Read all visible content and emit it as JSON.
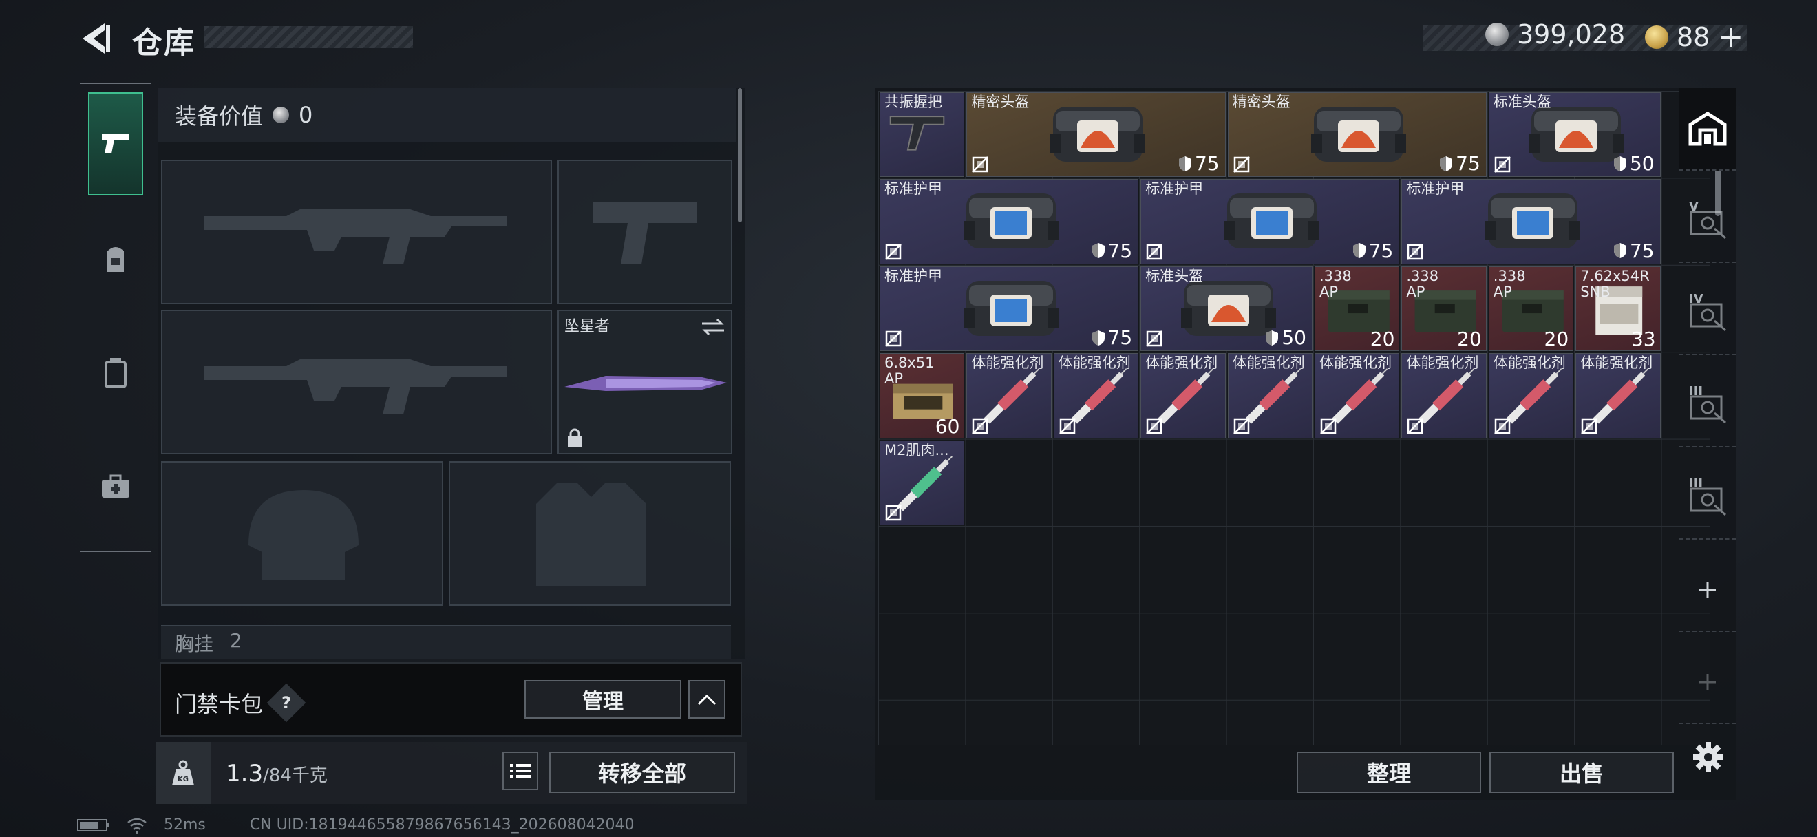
{
  "header": {
    "title": "仓库",
    "back_icon": "back-arrow-icon"
  },
  "currency": {
    "silver": "399,028",
    "gold": "88",
    "plus": "+"
  },
  "left_rail": {
    "tabs": [
      {
        "name": "weapon",
        "icon": "pistol-icon",
        "active": true
      },
      {
        "name": "gear",
        "icon": "backpack-icon",
        "active": false
      },
      {
        "name": "container",
        "icon": "canister-icon",
        "active": false
      },
      {
        "name": "kit",
        "icon": "medkit-icon",
        "active": false
      }
    ]
  },
  "loadout": {
    "equip_value_label": "装备价值",
    "equip_value": "0",
    "melee_name": "坠星者",
    "chest_label": "胸挂",
    "chest_count": "2"
  },
  "keycase": {
    "label": "门禁卡包",
    "help": "?",
    "manage": "管理"
  },
  "bottom_left": {
    "weight": "1.3",
    "weight_max": "/84千克",
    "transfer_all": "转移全部"
  },
  "stash": {
    "items": [
      {
        "name": "共振握把",
        "rarity": "purple",
        "cols": 1,
        "rows": 1,
        "r": 0,
        "c": 0,
        "art": "grip",
        "tag": ""
      },
      {
        "name": "精密头盔",
        "rarity": "gold",
        "cols": 3,
        "rows": 1,
        "r": 0,
        "c": 1,
        "art": "bag-orange",
        "tag": "75",
        "lock": true
      },
      {
        "name": "精密头盔",
        "rarity": "gold",
        "cols": 3,
        "rows": 1,
        "r": 0,
        "c": 4,
        "art": "bag-orange",
        "tag": "75",
        "lock": true
      },
      {
        "name": "标准头盔",
        "rarity": "purple",
        "cols": 2,
        "rows": 1,
        "r": 0,
        "c": 7,
        "art": "bag-orange",
        "tag": "50",
        "lock": true
      },
      {
        "name": "标准护甲",
        "rarity": "purple",
        "cols": 3,
        "rows": 1,
        "r": 1,
        "c": 0,
        "art": "bag-blue",
        "tag": "75",
        "lock": true
      },
      {
        "name": "标准护甲",
        "rarity": "purple",
        "cols": 3,
        "rows": 1,
        "r": 1,
        "c": 3,
        "art": "bag-blue",
        "tag": "75",
        "lock": true
      },
      {
        "name": "标准护甲",
        "rarity": "purple",
        "cols": 3,
        "rows": 1,
        "r": 1,
        "c": 6,
        "art": "bag-blue",
        "tag": "75",
        "lock": true
      },
      {
        "name": "标准护甲",
        "rarity": "purple",
        "cols": 3,
        "rows": 1,
        "r": 2,
        "c": 0,
        "art": "bag-blue",
        "tag": "75",
        "lock": true
      },
      {
        "name": "标准头盔",
        "rarity": "purple",
        "cols": 2,
        "rows": 1,
        "r": 2,
        "c": 3,
        "art": "bag-orange",
        "tag": "50",
        "lock": true
      },
      {
        "name": ".338\nAP",
        "rarity": "red",
        "cols": 1,
        "rows": 1,
        "r": 2,
        "c": 5,
        "art": "ammo-box",
        "qty": "20"
      },
      {
        "name": ".338\nAP",
        "rarity": "red",
        "cols": 1,
        "rows": 1,
        "r": 2,
        "c": 6,
        "art": "ammo-box",
        "qty": "20"
      },
      {
        "name": ".338\nAP",
        "rarity": "red",
        "cols": 1,
        "rows": 1,
        "r": 2,
        "c": 7,
        "art": "ammo-box",
        "qty": "20"
      },
      {
        "name": "7.62x54R\nSNB",
        "rarity": "red",
        "cols": 1,
        "rows": 1,
        "r": 2,
        "c": 8,
        "art": "ammo-white",
        "qty": "33"
      },
      {
        "name": "6.8x51\nAP",
        "rarity": "red",
        "cols": 1,
        "rows": 1,
        "r": 3,
        "c": 0,
        "art": "ammo-tan",
        "qty": "60"
      },
      {
        "name": "体能强化剂",
        "rarity": "purple",
        "cols": 1,
        "rows": 1,
        "r": 3,
        "c": 1,
        "art": "syringe-red",
        "lock": true
      },
      {
        "name": "体能强化剂",
        "rarity": "purple",
        "cols": 1,
        "rows": 1,
        "r": 3,
        "c": 2,
        "art": "syringe-red",
        "lock": true
      },
      {
        "name": "体能强化剂",
        "rarity": "purple",
        "cols": 1,
        "rows": 1,
        "r": 3,
        "c": 3,
        "art": "syringe-red",
        "lock": true
      },
      {
        "name": "体能强化剂",
        "rarity": "purple",
        "cols": 1,
        "rows": 1,
        "r": 3,
        "c": 4,
        "art": "syringe-red",
        "lock": true
      },
      {
        "name": "体能强化剂",
        "rarity": "purple",
        "cols": 1,
        "rows": 1,
        "r": 3,
        "c": 5,
        "art": "syringe-red",
        "lock": true
      },
      {
        "name": "体能强化剂",
        "rarity": "purple",
        "cols": 1,
        "rows": 1,
        "r": 3,
        "c": 6,
        "art": "syringe-red",
        "lock": true
      },
      {
        "name": "体能强化剂",
        "rarity": "purple",
        "cols": 1,
        "rows": 1,
        "r": 3,
        "c": 7,
        "art": "syringe-red",
        "lock": true
      },
      {
        "name": "体能强化剂",
        "rarity": "purple",
        "cols": 1,
        "rows": 1,
        "r": 3,
        "c": 8,
        "art": "syringe-red",
        "lock": true
      },
      {
        "name": "M2肌肉...",
        "rarity": "purple",
        "cols": 1,
        "rows": 1,
        "r": 4,
        "c": 0,
        "art": "syringe-green",
        "lock": true
      }
    ],
    "organize": "整理",
    "sell": "出售"
  },
  "right_rail": {
    "items": [
      {
        "icon": "stash-icon",
        "active": true
      },
      {
        "icon": "v-safe-icon",
        "label": "V"
      },
      {
        "icon": "iv-safe-icon",
        "label": "IV"
      },
      {
        "icon": "iii-safe-icon",
        "label": "III"
      },
      {
        "icon": "iii-safe-icon-2",
        "label": "III"
      },
      {
        "icon": "plus-icon"
      },
      {
        "icon": "plus-icon-dim"
      }
    ],
    "settings_icon": "gear-icon"
  },
  "status": {
    "ping": "52ms",
    "uid": "CN UID:181944655879867656143_202608042040"
  },
  "colors": {
    "accent_green": "#3fbf8f",
    "rarity_purple": "#3b3a5c",
    "rarity_gold": "#5a4a34",
    "rarity_red": "#5a2f33"
  }
}
